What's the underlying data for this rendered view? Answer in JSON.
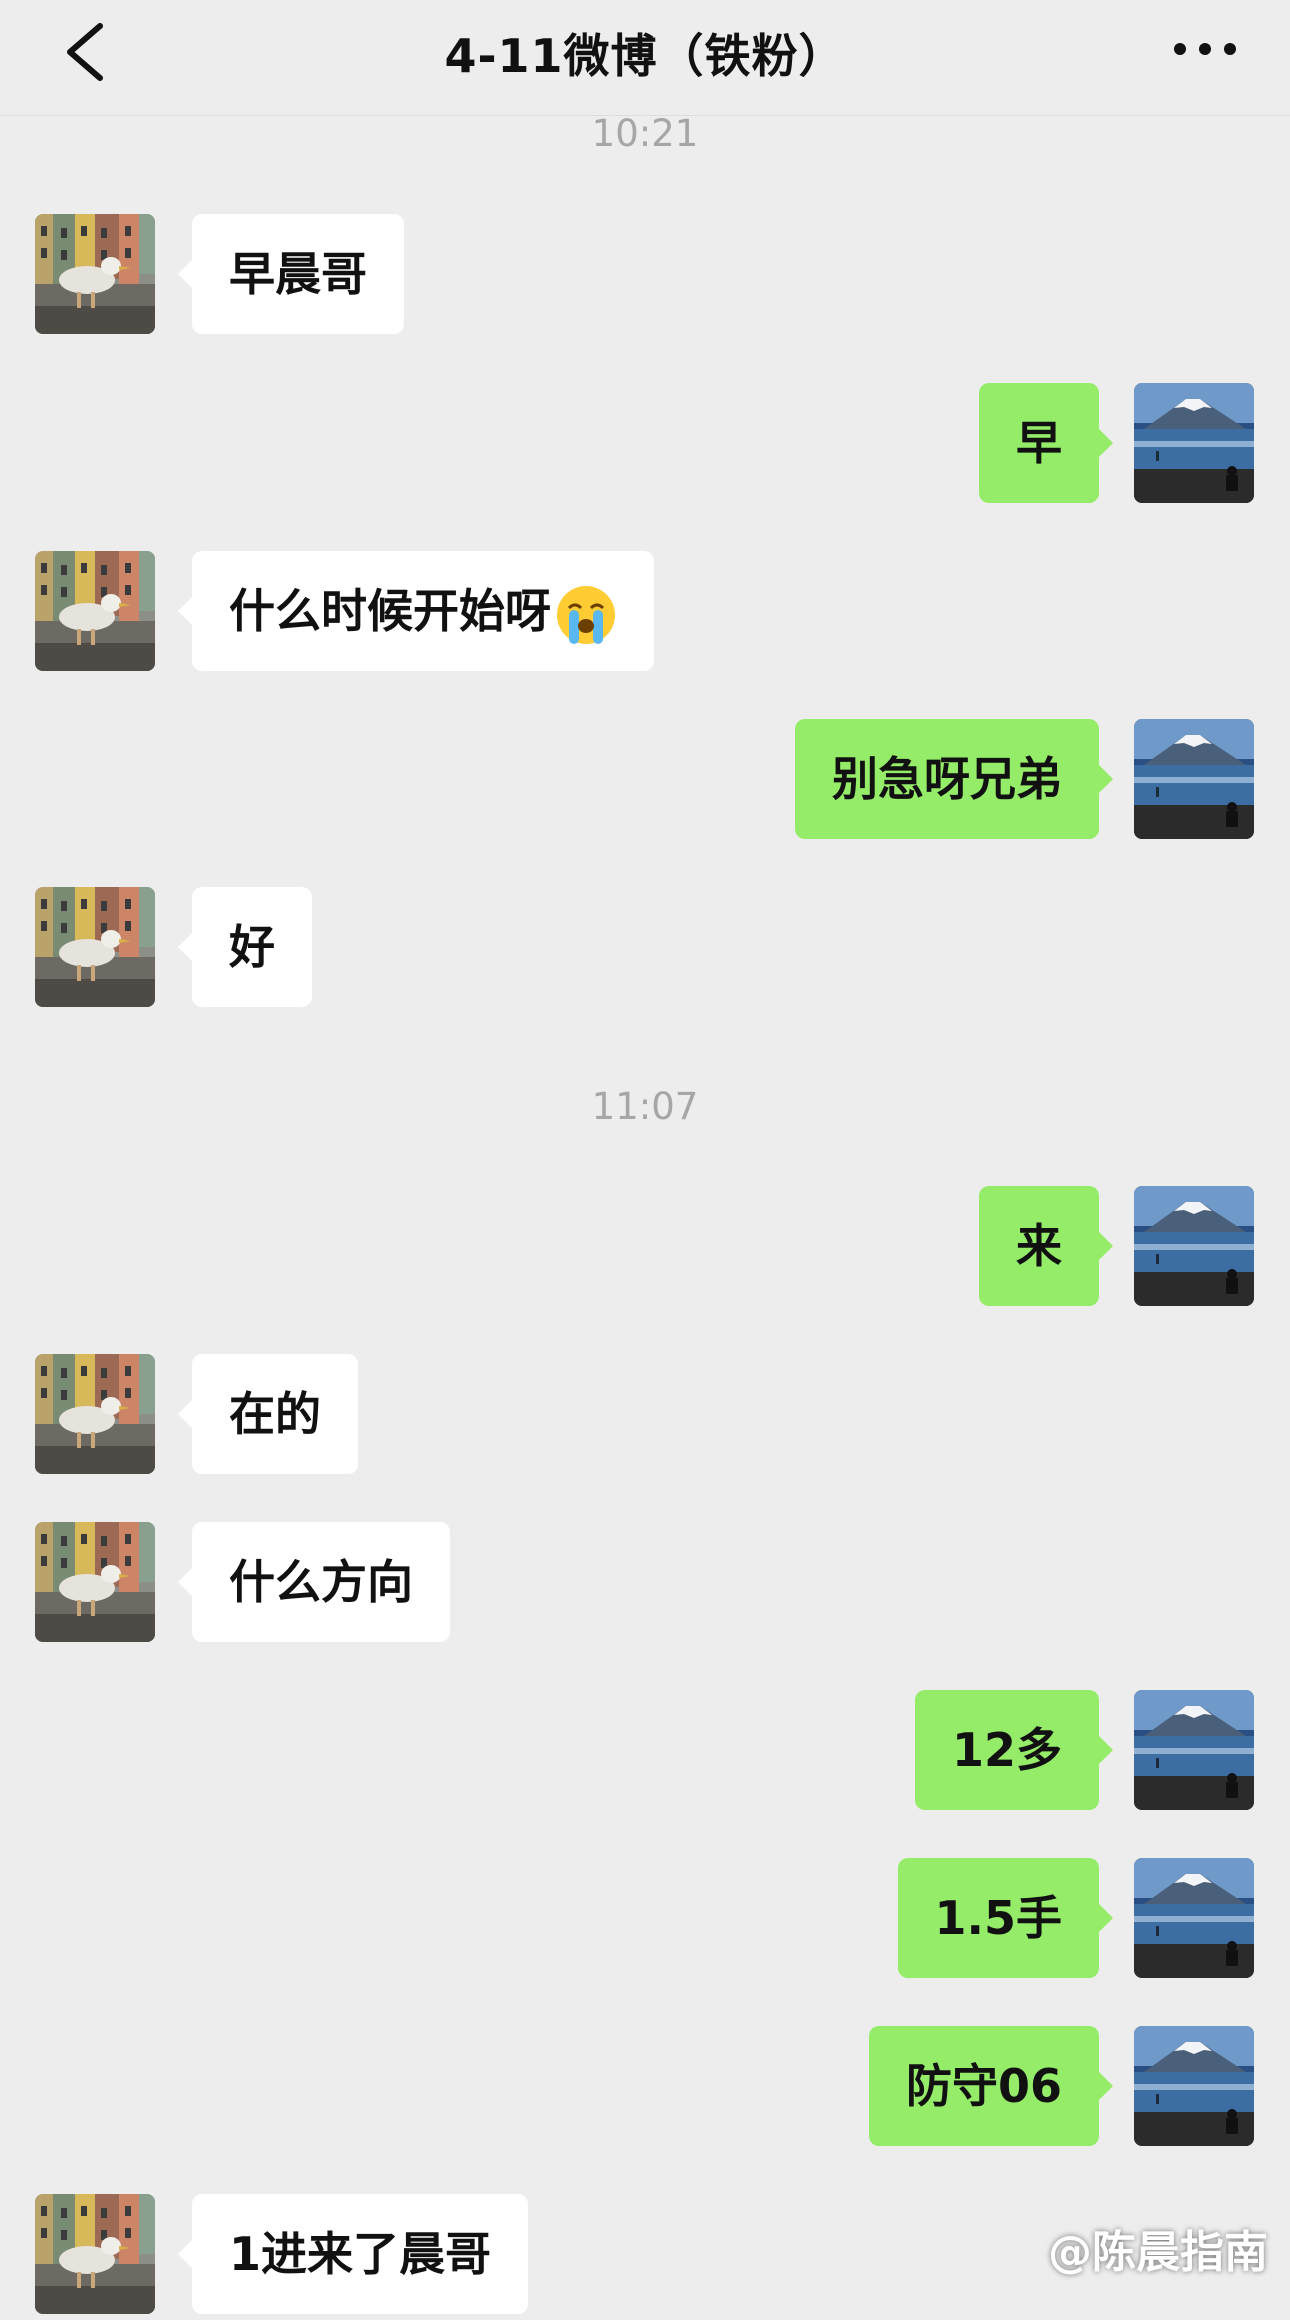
{
  "header": {
    "title": "4-11微博（铁粉）",
    "back_icon": "chevron-left-icon",
    "more_icon": "more-dots-icon"
  },
  "times": [
    "10:21",
    "11:07"
  ],
  "messages": [
    {
      "side": "in",
      "text": "早晨哥"
    },
    {
      "side": "out",
      "text": "早"
    },
    {
      "side": "in",
      "text": "什么时候开始呀",
      "emoji": "crying-face-emoji"
    },
    {
      "side": "out",
      "text": "别急呀兄弟"
    },
    {
      "side": "in",
      "text": "好"
    },
    {
      "side": "out",
      "text": "来"
    },
    {
      "side": "in",
      "text": "在的"
    },
    {
      "side": "in",
      "text": "什么方向"
    },
    {
      "side": "out",
      "text": "12多"
    },
    {
      "side": "out",
      "text": "1.5手"
    },
    {
      "side": "out",
      "text": "防守06"
    },
    {
      "side": "in",
      "text": "1进来了晨哥"
    }
  ],
  "watermark": "@陈晨指南",
  "colors": {
    "background": "#ededed",
    "incoming_bubble": "#ffffff",
    "outgoing_bubble": "#95ec69",
    "time_text": "#a6a6a6"
  }
}
